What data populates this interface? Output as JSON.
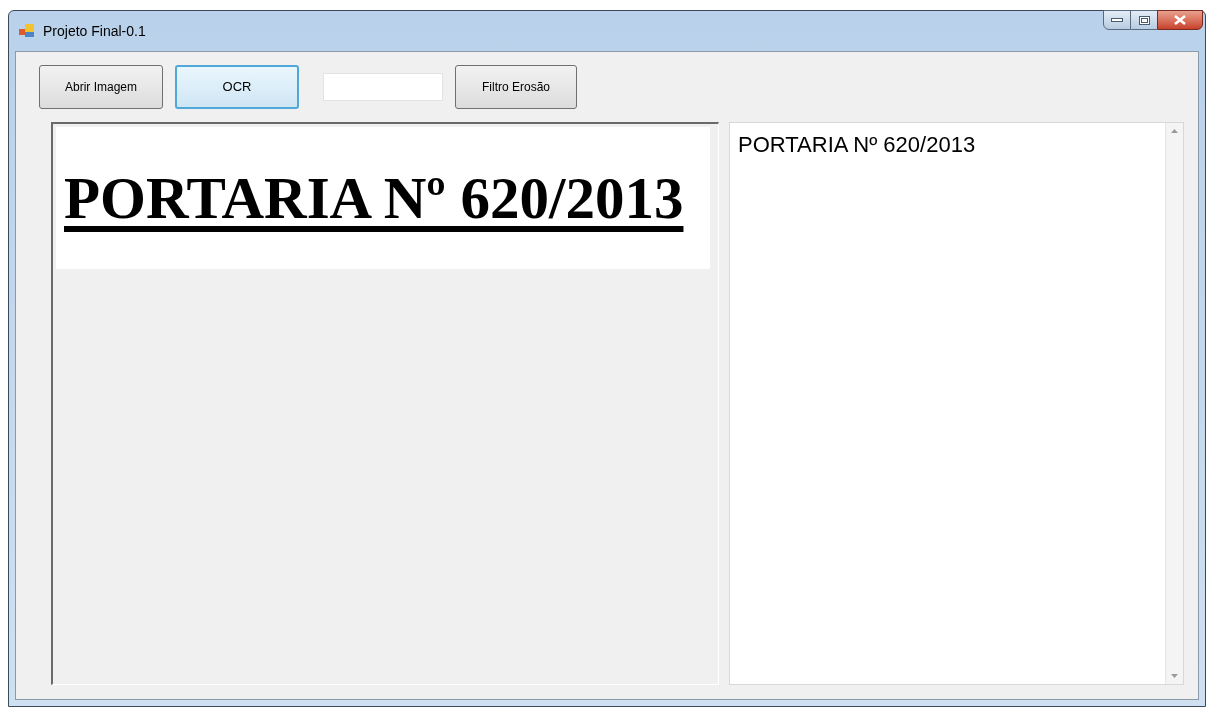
{
  "window": {
    "title": "Projeto Final-0.1"
  },
  "toolbar": {
    "open_button": "Abrir Imagem",
    "ocr_button": "OCR",
    "ocr_focused": true,
    "erosion_button": "Filtro Erosão"
  },
  "image_panel": {
    "image_text": "PORTARIA Nº 620/2013"
  },
  "output_text": "PORTARIA Nº 620/2013"
}
